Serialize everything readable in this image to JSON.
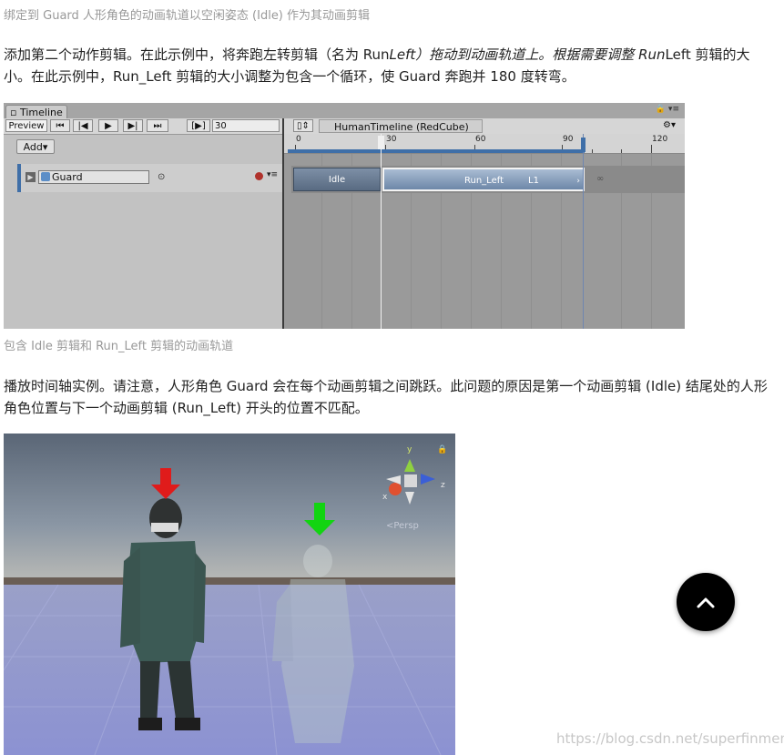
{
  "captions": {
    "top": "绑定到 Guard 人形角色的动画轨道以空闲姿态 (Idle) 作为其动画剪辑",
    "middle": "包含 Idle 剪辑和 Run_Left 剪辑的动画轨道"
  },
  "paragraph1": {
    "part1": "添加第二个动作剪辑。在此示例中，将奔跑左转剪辑（名为 Run",
    "part2_italic": "Left）拖动到动画轨道上。根据需要调整 Run",
    "part3": "Left 剪辑的大小。在此示例中，Run_Left 剪辑的大小调整为包含一个循环，使 Guard 奔跑并 180 度转弯。"
  },
  "paragraph2": "播放时间轴实例。请注意，人形角色 Guard 会在每个动画剪辑之间跳跃。此问题的原因是第一个动画剪辑 (Idle) 结尾处的人形角色位置与下一个动画剪辑 (Run_Left) 开头的位置不匹配。",
  "timeline": {
    "tab_label": "Timeline",
    "preview_label": "Preview",
    "transport": [
      "⏮",
      "|◀",
      "▶",
      "▶|",
      "⏭"
    ],
    "play_range_label": "[▶]",
    "frame_value": "30",
    "breadcrumb": "HumanTimeline (RedCube)",
    "add_label": "Add▾",
    "track_name": "Guard",
    "ruler_labels": [
      "0",
      "30",
      "60",
      "90",
      "120"
    ],
    "clips": [
      {
        "name": "Idle"
      },
      {
        "name": "Run_Left",
        "loop": "L1"
      }
    ],
    "loop_marker": "∞"
  },
  "scene": {
    "axis_labels": {
      "y": "y",
      "x": "x",
      "z": "z"
    },
    "persp_label": "<Persp",
    "arrows": [
      "red",
      "green"
    ]
  },
  "watermark": "https://blog.csdn.net/superfinmeng",
  "colors": {
    "accent": "#3f6fa8",
    "arrow_red": "#e01b1b",
    "arrow_green": "#12d412",
    "scroll_button": "#000000"
  }
}
